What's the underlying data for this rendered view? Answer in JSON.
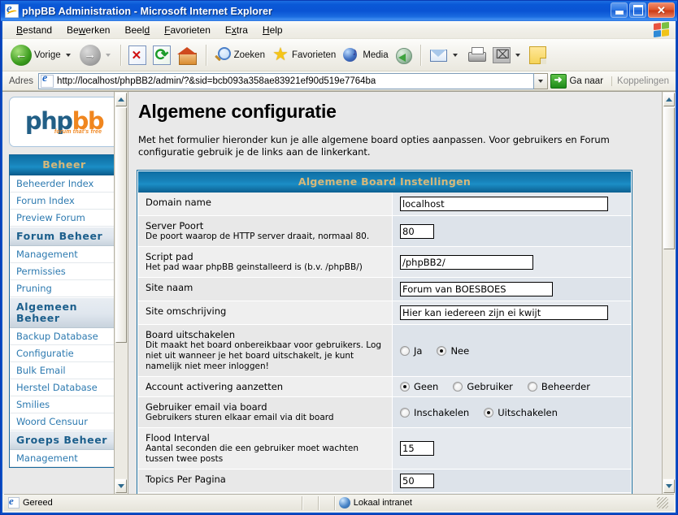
{
  "window": {
    "title": "phpBB Administration - Microsoft Internet Explorer",
    "icon": "ie-document-icon",
    "minimize_label": "Minimize",
    "maximize_label": "Maximize",
    "close_label": "Close"
  },
  "menubar": {
    "items": [
      {
        "label": "Bestand",
        "accel": "B"
      },
      {
        "label": "Bewerken",
        "accel": "w"
      },
      {
        "label": "Beeld",
        "accel": "l"
      },
      {
        "label": "Favorieten",
        "accel": "F"
      },
      {
        "label": "Extra",
        "accel": "x"
      },
      {
        "label": "Help",
        "accel": "H"
      }
    ]
  },
  "toolbar": {
    "back_label": "Vorige",
    "forward_label": "",
    "stop_label": "",
    "refresh_label": "",
    "home_label": "",
    "search_label": "Zoeken",
    "favorites_label": "Favorieten",
    "media_label": "Media",
    "history_label": "",
    "mail_label": "",
    "print_label": "",
    "edit_label": "",
    "notes_label": ""
  },
  "address": {
    "label": "Adres",
    "url": "http://localhost/phpBB2/admin/?&sid=bcb093a358ae83921ef90d519e7764ba",
    "go_label": "Ga naar",
    "links_label": "Koppelingen"
  },
  "sidebar": {
    "logo": {
      "part1": "php",
      "part2": "bb",
      "tagline": "forum that's free"
    },
    "items": [
      {
        "label": "Beheer",
        "type": "main-header"
      },
      {
        "label": "Beheerder Index",
        "type": "link"
      },
      {
        "label": "Forum Index",
        "type": "link"
      },
      {
        "label": "Preview Forum",
        "type": "link"
      },
      {
        "label": "Forum Beheer",
        "type": "section"
      },
      {
        "label": "Management",
        "type": "link"
      },
      {
        "label": "Permissies",
        "type": "link"
      },
      {
        "label": "Pruning",
        "type": "link"
      },
      {
        "label": "Algemeen Beheer",
        "type": "section"
      },
      {
        "label": "Backup Database",
        "type": "link"
      },
      {
        "label": "Configuratie",
        "type": "link"
      },
      {
        "label": "Bulk Email",
        "type": "link"
      },
      {
        "label": "Herstel Database",
        "type": "link"
      },
      {
        "label": "Smilies",
        "type": "link"
      },
      {
        "label": "Woord Censuur",
        "type": "link"
      },
      {
        "label": "Groeps Beheer",
        "type": "section"
      },
      {
        "label": "Management",
        "type": "link"
      }
    ]
  },
  "main": {
    "title": "Algemene configuratie",
    "intro": "Met het formulier hieronder kun je alle algemene board opties aanpassen. Voor gebruikers en Forum configuratie gebruik je de links aan de linkerkant.",
    "table_header": "Algemene Board Instellingen",
    "rows": [
      {
        "label": "Domain name",
        "sub": "",
        "control": "text",
        "value": "localhost",
        "width": "w-wide",
        "name": "domain-name"
      },
      {
        "label": "Server Poort",
        "sub": "De poort waarop de HTTP server draait, normaal 80.",
        "control": "text",
        "value": "80",
        "width": "w-small",
        "name": "server-port"
      },
      {
        "label": "Script pad",
        "sub": "Het pad waar phpBB geinstalleerd is (b.v. /phpBB/)",
        "control": "text",
        "value": "/phpBB2/",
        "width": "w-mid",
        "name": "script-path"
      },
      {
        "label": "Site naam",
        "sub": "",
        "control": "text",
        "value": "Forum van BOESBOES",
        "width": "w-site",
        "name": "site-name"
      },
      {
        "label": "Site omschrijving",
        "sub": "",
        "control": "text",
        "value": "Hier kan iedereen zijn ei kwijt",
        "width": "w-wide",
        "name": "site-description"
      },
      {
        "label": "Board uitschakelen",
        "sub": "Dit maakt het board onbereikbaar voor gebruikers. Log niet uit wanneer je het board uitschakelt, je kunt namelijk niet meer inloggen!",
        "control": "radio",
        "options": [
          {
            "label": "Ja",
            "selected": false
          },
          {
            "label": "Nee",
            "selected": true
          }
        ],
        "name": "board-disable"
      },
      {
        "label": "Account activering aanzetten",
        "sub": "",
        "control": "radio",
        "options": [
          {
            "label": "Geen",
            "selected": true
          },
          {
            "label": "Gebruiker",
            "selected": false
          },
          {
            "label": "Beheerder",
            "selected": false
          }
        ],
        "name": "account-activation"
      },
      {
        "label": "Gebruiker email via board",
        "sub": "Gebruikers sturen elkaar email via dit board",
        "control": "radio",
        "options": [
          {
            "label": "Inschakelen",
            "selected": false
          },
          {
            "label": "Uitschakelen",
            "selected": true
          }
        ],
        "name": "board-email"
      },
      {
        "label": "Flood Interval",
        "sub": "Aantal seconden die een gebruiker moet wachten tussen twee posts",
        "control": "text",
        "value": "15",
        "width": "w-small",
        "name": "flood-interval"
      },
      {
        "label": "Topics Per Pagina",
        "sub": "",
        "control": "text",
        "value": "50",
        "width": "w-small",
        "name": "topics-per-page"
      }
    ]
  },
  "statusbar": {
    "status": "Gereed",
    "zone": "Lokaal intranet"
  },
  "colors": {
    "titlebar_blue": "#0a54d4",
    "phpbb_blue": "#225f86",
    "phpbb_orange": "#f0861f",
    "panel_header_blue": "#1782b9",
    "panel_header_text": "#d6b87a",
    "link_blue": "#2d7ab0",
    "section_text": "#1c5f8c"
  }
}
